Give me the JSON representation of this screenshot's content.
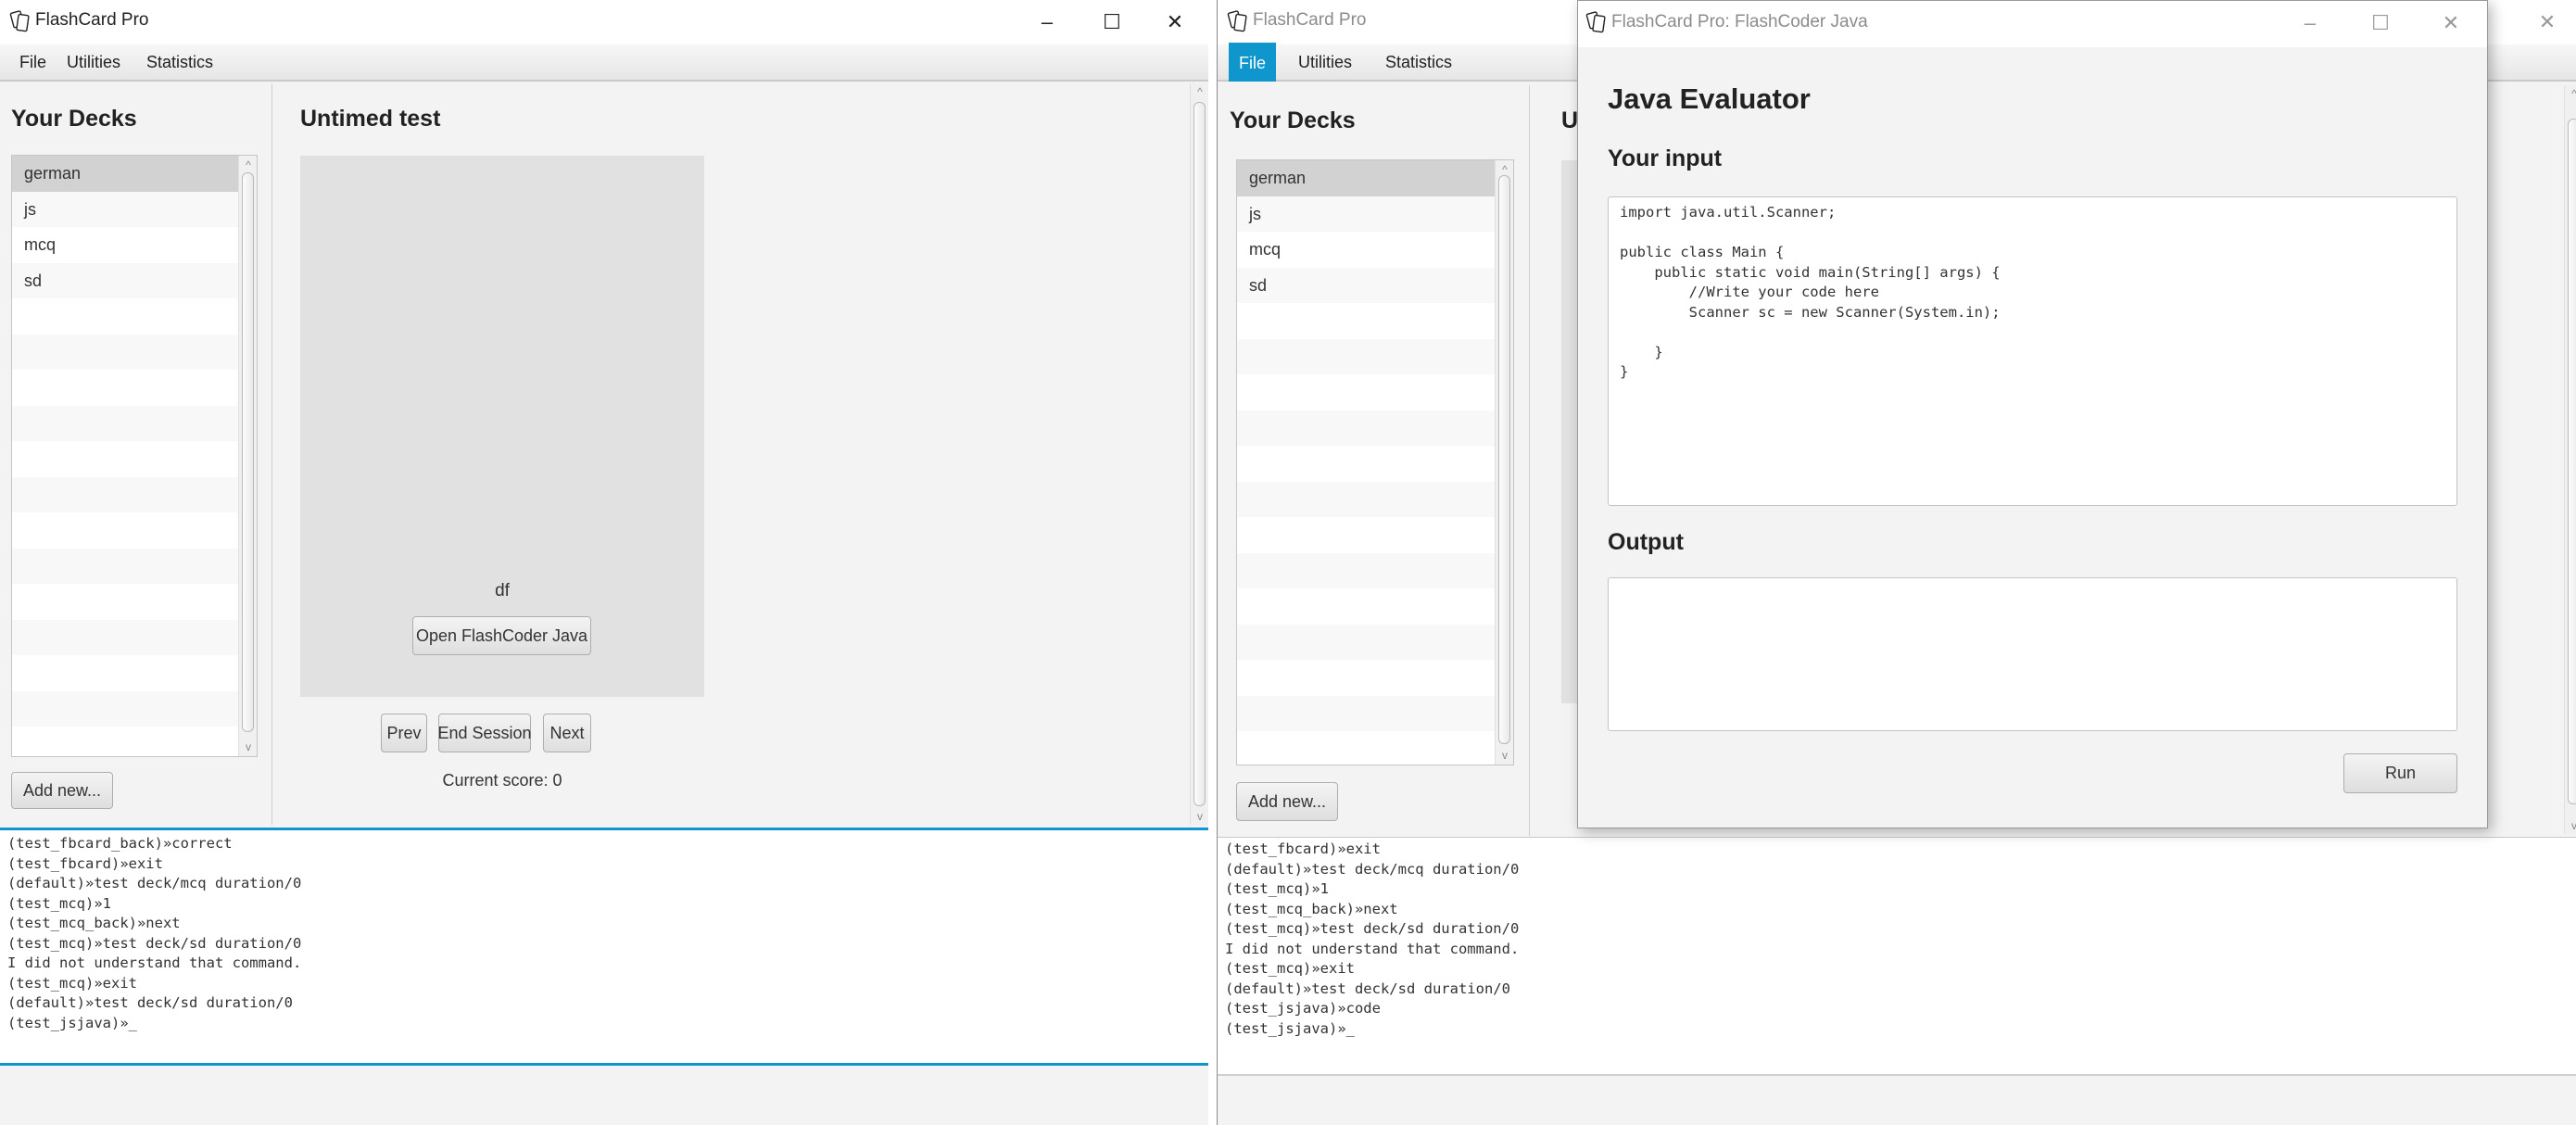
{
  "left_window": {
    "title": "FlashCard Pro",
    "controls": {
      "minimize": "–",
      "maximize": "☐",
      "close": "✕"
    },
    "menu": [
      "File",
      "Utilities",
      "Statistics"
    ],
    "decks_heading": "Your Decks",
    "decks": [
      "german",
      "js",
      "mcq",
      "sd"
    ],
    "selected_deck": "german",
    "add_new_label": "Add new...",
    "main_heading": "Untimed test",
    "card_text": "df",
    "open_flashcoder_label": "Open FlashCoder Java",
    "prev_label": "Prev",
    "end_session_label": "End Session",
    "next_label": "Next",
    "score_text": "Current score: 0",
    "console_lines": [
      "(test_fbcard_back)»correct",
      "(test_fbcard)»exit",
      "(default)»test deck/mcq duration/0",
      "(test_mcq)»1",
      "(test_mcq_back)»next",
      "(test_mcq)»test deck/sd duration/0",
      "I did not understand that command.",
      "(test_mcq)»exit",
      "(default)»test deck/sd duration/0",
      "(test_jsjava)»_"
    ]
  },
  "right_window": {
    "title": "FlashCard Pro",
    "menu": [
      "File",
      "Utilities",
      "Statistics"
    ],
    "active_menu": "File",
    "decks_heading": "Your Decks",
    "decks": [
      "german",
      "js",
      "mcq",
      "sd"
    ],
    "selected_deck": "german",
    "add_new_label": "Add new...",
    "main_heading_partial": "U",
    "close_glyph": "✕",
    "console_lines": [
      "(test_fbcard)»exit",
      "(default)»test deck/mcq duration/0",
      "(test_mcq)»1",
      "(test_mcq_back)»next",
      "(test_mcq)»test deck/sd duration/0",
      "I did not understand that command.",
      "(test_mcq)»exit",
      "(default)»test deck/sd duration/0",
      "(test_jsjava)»code",
      "(test_jsjava)»_"
    ]
  },
  "dialog": {
    "title": "FlashCard Pro: FlashCoder Java",
    "controls": {
      "minimize": "–",
      "maximize": "☐",
      "close": "✕"
    },
    "heading": "Java Evaluator",
    "input_label": "Your input",
    "input_code": "import java.util.Scanner;\n\npublic class Main {\n    public static void main(String[] args) {\n        //Write your code here\n        Scanner sc = new Scanner(System.in);\n\n    }\n}",
    "output_label": "Output",
    "output_value": "",
    "run_label": "Run"
  },
  "colors": {
    "accent": "#0e96cd",
    "background": "#f3f3f3",
    "card": "#e1e1e1",
    "selected_row": "#d2d2d2"
  }
}
